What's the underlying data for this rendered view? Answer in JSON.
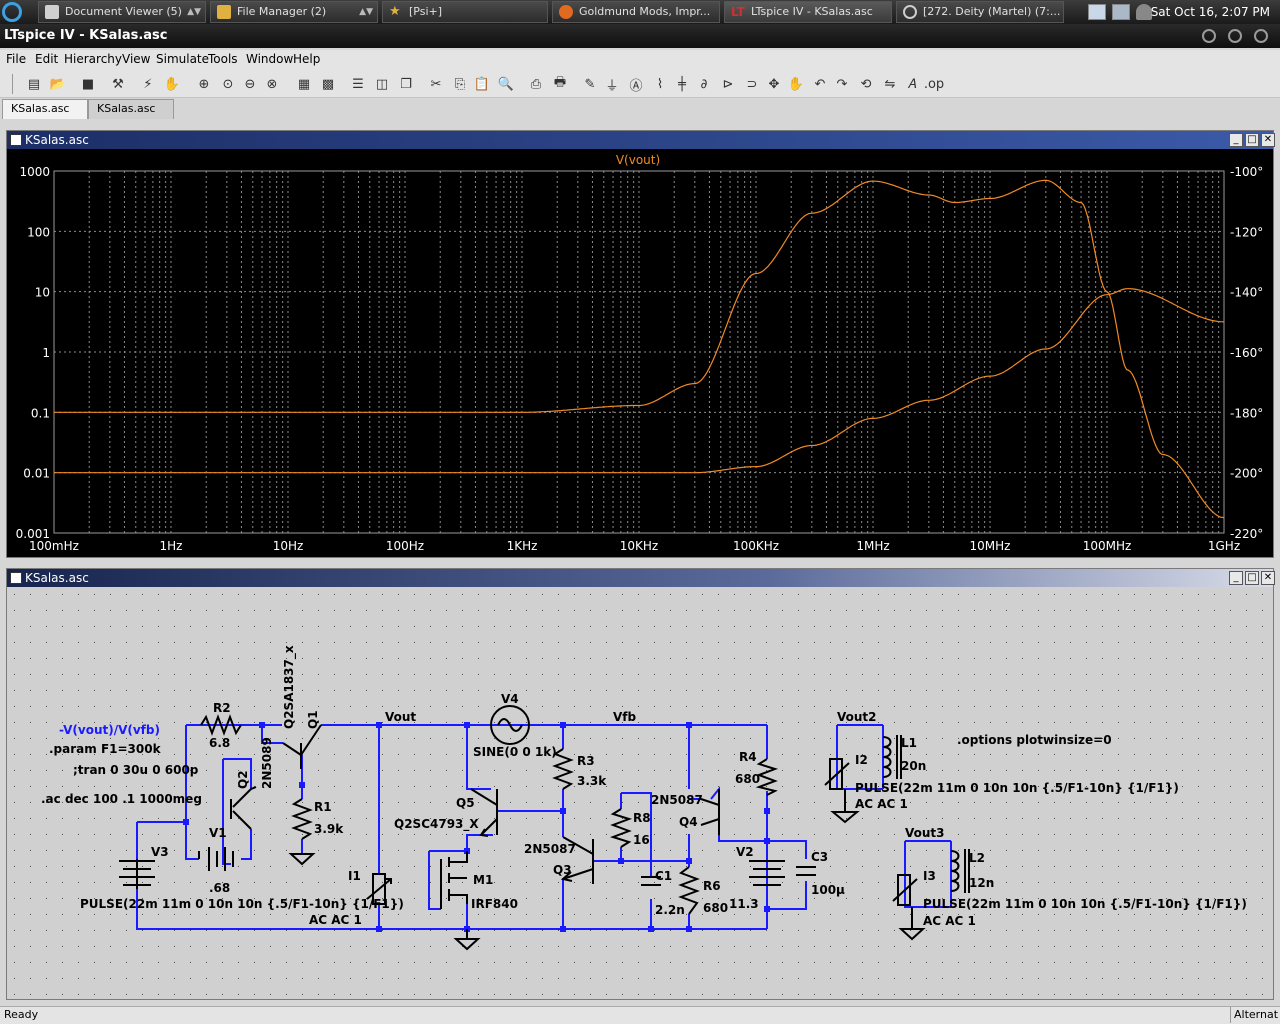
{
  "taskbar": {
    "tasks": [
      {
        "label": "Document Viewer (5)"
      },
      {
        "label": "File Manager (2)"
      },
      {
        "label": "[Psi+]"
      },
      {
        "label": "Goldmund Mods, Impr..."
      },
      {
        "label": "LTspice IV - KSalas.asc"
      },
      {
        "label": "[272. Deity (Martel) (7:..."
      }
    ],
    "clock": "Sat Oct 16,  2:07 PM"
  },
  "window": {
    "title": "LTspice IV - KSalas.asc"
  },
  "menu": [
    "File",
    "Edit",
    "Hierarchy",
    "View",
    "Simulate",
    "Tools",
    "Window",
    "Help"
  ],
  "tabs": [
    "KSalas.asc",
    "KSalas.asc"
  ],
  "plot_window": {
    "title": "KSalas.asc"
  },
  "schematic_window": {
    "title": "KSalas.asc"
  },
  "status": {
    "left": "Ready",
    "right": "Alternat"
  },
  "colors": {
    "trace": "#f08a24",
    "wire": "#1a1aff",
    "plot_bg": "#000000",
    "grid": "#8c8c8c",
    "schematic_bg": "#d0d0d0"
  },
  "chart_data": {
    "type": "line",
    "title": "V(vout)",
    "x_scale": "log",
    "xlim": [
      0.1,
      1000000000
    ],
    "x_tick_labels": [
      "100mHz",
      "1Hz",
      "10Hz",
      "100Hz",
      "1KHz",
      "10KHz",
      "100KHz",
      "1MHz",
      "10MHz",
      "100MHz",
      "1GHz"
    ],
    "y_scale": "log",
    "ylim": [
      0.001,
      1000
    ],
    "y_tick_labels": [
      "1000",
      "100",
      "10",
      "1",
      "0.1",
      "0.01",
      "0.001"
    ],
    "y2lim": [
      -220,
      -100
    ],
    "y2_tick_labels": [
      "-100°",
      "-120°",
      "-140°",
      "-160°",
      "-180°",
      "-200°",
      "-220°"
    ],
    "series": [
      {
        "axis": "y",
        "points": [
          [
            0.1,
            0.1
          ],
          [
            1000,
            0.1
          ],
          [
            10000,
            0.13
          ],
          [
            30000,
            0.3
          ],
          [
            100000,
            20
          ],
          [
            300000,
            200
          ],
          [
            1000000,
            680
          ],
          [
            3000000,
            400
          ],
          [
            5000000,
            300
          ],
          [
            10000000,
            350
          ],
          [
            30000000,
            700
          ],
          [
            60000000,
            300
          ],
          [
            100000000,
            10
          ],
          [
            150000000,
            0.5
          ],
          [
            300000000,
            0.02
          ],
          [
            1000000000,
            0.0018
          ]
        ]
      },
      {
        "axis": "y2",
        "points": [
          [
            0.1,
            -200
          ],
          [
            30000,
            -200
          ],
          [
            100000,
            -198
          ],
          [
            300000,
            -191
          ],
          [
            1000000,
            -182
          ],
          [
            3000000,
            -176
          ],
          [
            10000000,
            -168
          ],
          [
            30000000,
            -159
          ],
          [
            100000000,
            -141
          ],
          [
            150000000,
            -139
          ],
          [
            1000000000,
            -150
          ]
        ]
      }
    ]
  },
  "schematic": {
    "labels": {
      "ratio": "-V(vout)/V(vfb)",
      "param": ".param F1=300k",
      "tran": ";tran 0 30u 0 600p",
      "ac": ".ac dec 100 .1 1000meg",
      "options": ".options plotwinsize=0",
      "vout": "Vout",
      "vfb": "Vfb",
      "vout2": "Vout2",
      "vout3": "Vout3",
      "v4": "V4",
      "sine": "SINE(0 0 1k)",
      "r2": "R2",
      "r2v": "6.8",
      "q1": "Q1",
      "q1m": "Q2SA1837_x",
      "q2": "Q2",
      "q2m": "2N5089",
      "r1": "R1",
      "r1v": "3.9k",
      "v1": "V1",
      "v1v": ".68",
      "v3": "V3",
      "pulse": "PULSE(22m 11m 0 10n 10n {.5/F1-10n} {1/F1})",
      "acac": "AC AC 1",
      "i1": "I1",
      "q5": "Q5",
      "q5m": "Q2SC4793_X",
      "m1": "M1",
      "m1m": "IRF840",
      "r3": "R3",
      "r3v": "3.3k",
      "q3": "Q3",
      "q3m": "2N5087",
      "r8": "R8",
      "r8v": "16",
      "c1": "C1",
      "c1v": "2.2n",
      "q4": "Q4",
      "q4m": "2N5087",
      "r6": "R6",
      "r6v": "680",
      "r4": "R4",
      "r4v": "680",
      "v2": "V2",
      "v2v": "11.3",
      "c3": "C3",
      "c3v": "100µ",
      "i2": "I2",
      "l1": "L1",
      "l1v": "20n",
      "i3": "I3",
      "l2": "L2",
      "l2v": "12n"
    }
  }
}
